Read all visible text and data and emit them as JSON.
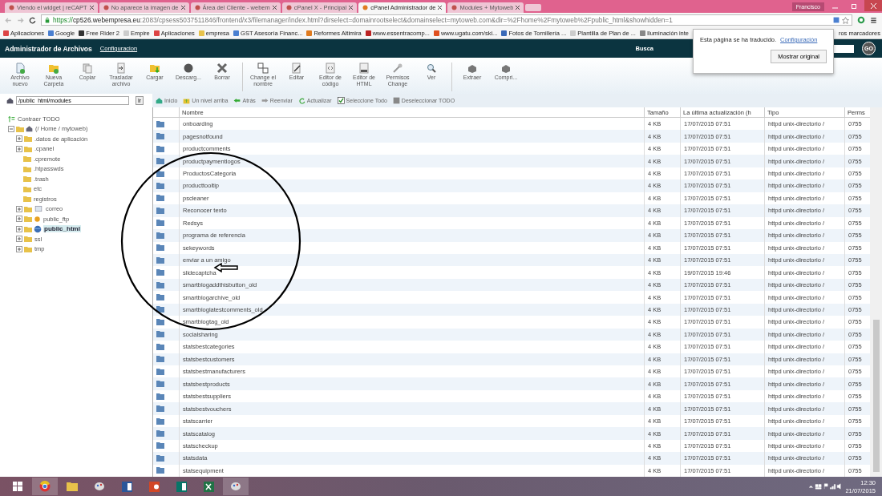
{
  "browser": {
    "tabs": [
      {
        "title": "Viendo el widget | reCAPT",
        "selected": false
      },
      {
        "title": "No aparece la imagen de",
        "selected": false
      },
      {
        "title": "Área del Cliente - webem",
        "selected": false
      },
      {
        "title": "cPanel X - Principal",
        "selected": false
      },
      {
        "title": "cPanel Administrador de",
        "selected": true
      },
      {
        "title": "Modules + Mytoweb",
        "selected": false
      }
    ],
    "profile": "Francisco",
    "url": {
      "scheme": "https://",
      "host": "cp526.webempresa.eu",
      "rest": ":2083/cpsess5037511846/frontend/x3/filemanager/index.html?dirselect=domainrootselect&domainselect=mytoweb.com&dir=%2Fhome%2Fmytoweb%2Fpublic_html&showhidden=1"
    },
    "bookmarks": [
      "Aplicaciones",
      "Google",
      "Free Rider 2",
      "Empire",
      "Aplicaciones",
      "empresa",
      "GST Asesoría Financ...",
      "Reformes Altimira",
      "www.essentracomp...",
      "www.ugatu.com/ski...",
      "Fotos de Tornillería ...",
      "Plantilla de Plan de ...",
      "Iluminación inte",
      "ros marcadores"
    ]
  },
  "translate_popup": {
    "message": "Esta página se ha traducido.",
    "link": "Configuración",
    "button": "Mostrar original"
  },
  "header": {
    "title": "Administrador de Archivos",
    "settings_link": "Configuracion",
    "search_label": "Busca",
    "go": "GO"
  },
  "toolbar": [
    [
      "Archivo nuevo",
      "Nueva Carpeta",
      "Copiar",
      "Trasladar archivo",
      "Cargar",
      "Descarg...",
      "Borrar"
    ],
    [
      "Change el nombre",
      "Editar",
      "Editor de código",
      "Editor de HTML",
      "Permisos Change",
      "Ver"
    ],
    [
      "Extraer",
      "Compri..."
    ]
  ],
  "path_bar": {
    "path": "/public_html/modules",
    "go": "Ir",
    "nav": [
      "Inicio",
      "Un nivel arriba",
      "Atrás",
      "Reenviar",
      "Actualizar",
      "Seleccione Todo",
      "Deseleccionar TODO"
    ]
  },
  "tree": {
    "collapse_all": "Contraer TODO",
    "root": {
      "label": "(/ Home / mytoweb)",
      "expanded": true,
      "children": [
        {
          "label": ".datos de aplicación",
          "kind": "folder",
          "expandable": true,
          "selected": false
        },
        {
          "label": ".cpanel",
          "kind": "folder",
          "expandable": true,
          "selected": false
        },
        {
          "label": ".cpremote",
          "kind": "folder",
          "expandable": false,
          "selected": false
        },
        {
          "label": ".htpasswds",
          "kind": "folder",
          "expandable": false,
          "selected": false
        },
        {
          "label": ".trash",
          "kind": "folder",
          "expandable": false,
          "selected": false
        },
        {
          "label": "etc",
          "kind": "folder",
          "expandable": false,
          "selected": false
        },
        {
          "label": "registros",
          "kind": "folder",
          "expandable": false,
          "selected": false
        },
        {
          "label": "correo",
          "kind": "mail",
          "expandable": true,
          "selected": false
        },
        {
          "label": "public_ftp",
          "kind": "ftp",
          "expandable": true,
          "selected": false
        },
        {
          "label": "public_html",
          "kind": "web",
          "expandable": true,
          "selected": true
        },
        {
          "label": "ssl",
          "kind": "folder",
          "expandable": true,
          "selected": false
        },
        {
          "label": "tmp",
          "kind": "folder",
          "expandable": true,
          "selected": false
        }
      ]
    }
  },
  "table": {
    "columns": [
      "Nombre",
      "Tamaño",
      "La última actualización (h",
      "Tipo",
      "Perms"
    ],
    "rows": [
      {
        "name": "onboarding",
        "size": "4 KB",
        "modified": "17/07/2015 07:51",
        "type": "httpd unix-directorio /",
        "perms": "0755"
      },
      {
        "name": "pagesnotfound",
        "size": "4 KB",
        "modified": "17/07/2015 07:51",
        "type": "httpd unix-directorio /",
        "perms": "0755"
      },
      {
        "name": "productcomments",
        "size": "4 KB",
        "modified": "17/07/2015 07:51",
        "type": "httpd unix-directorio /",
        "perms": "0755"
      },
      {
        "name": "productpaymentlogos",
        "size": "4 KB",
        "modified": "17/07/2015 07:51",
        "type": "httpd unix-directorio /",
        "perms": "0755"
      },
      {
        "name": "ProductosCategoria",
        "size": "4 KB",
        "modified": "17/07/2015 07:51",
        "type": "httpd unix-directorio /",
        "perms": "0755"
      },
      {
        "name": "producttooltip",
        "size": "4 KB",
        "modified": "17/07/2015 07:51",
        "type": "httpd unix-directorio /",
        "perms": "0755"
      },
      {
        "name": "pscleaner",
        "size": "4 KB",
        "modified": "17/07/2015 07:51",
        "type": "httpd unix-directorio /",
        "perms": "0755"
      },
      {
        "name": "Reconocer texto",
        "size": "4 KB",
        "modified": "17/07/2015 07:51",
        "type": "httpd unix-directorio /",
        "perms": "0755"
      },
      {
        "name": "Redsys",
        "size": "4 KB",
        "modified": "17/07/2015 07:51",
        "type": "httpd unix-directorio /",
        "perms": "0755"
      },
      {
        "name": "programa de referencia",
        "size": "4 KB",
        "modified": "17/07/2015 07:51",
        "type": "httpd unix-directorio /",
        "perms": "0755"
      },
      {
        "name": "sekeywords",
        "size": "4 KB",
        "modified": "17/07/2015 07:51",
        "type": "httpd unix-directorio /",
        "perms": "0755"
      },
      {
        "name": "enviar a un amigo",
        "size": "4 KB",
        "modified": "17/07/2015 07:51",
        "type": "httpd unix-directorio /",
        "perms": "0755"
      },
      {
        "name": "slidecaptcha",
        "size": "4 KB",
        "modified": "19/07/2015 19:46",
        "type": "httpd unix-directorio /",
        "perms": "0755"
      },
      {
        "name": "smartblogaddthisbutton_old",
        "size": "4 KB",
        "modified": "17/07/2015 07:51",
        "type": "httpd unix-directorio /",
        "perms": "0755"
      },
      {
        "name": "smartblogarchive_old",
        "size": "4 KB",
        "modified": "17/07/2015 07:51",
        "type": "httpd unix-directorio /",
        "perms": "0755"
      },
      {
        "name": "smartbloglatestcomments_old",
        "size": "4 KB",
        "modified": "17/07/2015 07:51",
        "type": "httpd unix-directorio /",
        "perms": "0755"
      },
      {
        "name": "smartblogtag_old",
        "size": "4 KB",
        "modified": "17/07/2015 07:51",
        "type": "httpd unix-directorio /",
        "perms": "0755"
      },
      {
        "name": "socialsharing",
        "size": "4 KB",
        "modified": "17/07/2015 07:51",
        "type": "httpd unix-directorio /",
        "perms": "0755"
      },
      {
        "name": "statsbestcategories",
        "size": "4 KB",
        "modified": "17/07/2015 07:51",
        "type": "httpd unix-directorio /",
        "perms": "0755"
      },
      {
        "name": "statsbestcustomers",
        "size": "4 KB",
        "modified": "17/07/2015 07:51",
        "type": "httpd unix-directorio /",
        "perms": "0755"
      },
      {
        "name": "statsbestmanufacturers",
        "size": "4 KB",
        "modified": "17/07/2015 07:51",
        "type": "httpd unix-directorio /",
        "perms": "0755"
      },
      {
        "name": "statsbestproducts",
        "size": "4 KB",
        "modified": "17/07/2015 07:51",
        "type": "httpd unix-directorio /",
        "perms": "0755"
      },
      {
        "name": "statsbestsuppliers",
        "size": "4 KB",
        "modified": "17/07/2015 07:51",
        "type": "httpd unix-directorio /",
        "perms": "0755"
      },
      {
        "name": "statsbestvouchers",
        "size": "4 KB",
        "modified": "17/07/2015 07:51",
        "type": "httpd unix-directorio /",
        "perms": "0755"
      },
      {
        "name": "statscarrier",
        "size": "4 KB",
        "modified": "17/07/2015 07:51",
        "type": "httpd unix-directorio /",
        "perms": "0755"
      },
      {
        "name": "statscatalog",
        "size": "4 KB",
        "modified": "17/07/2015 07:51",
        "type": "httpd unix-directorio /",
        "perms": "0755"
      },
      {
        "name": "statscheckup",
        "size": "4 KB",
        "modified": "17/07/2015 07:51",
        "type": "httpd unix-directorio /",
        "perms": "0755"
      },
      {
        "name": "statsdata",
        "size": "4 KB",
        "modified": "17/07/2015 07:51",
        "type": "httpd unix-directorio /",
        "perms": "0755"
      },
      {
        "name": "statsequipment",
        "size": "4 KB",
        "modified": "17/07/2015 07:51",
        "type": "httpd unix-directorio /",
        "perms": "0755"
      }
    ]
  },
  "taskbar": {
    "time": "12:30",
    "date": "21/07/2015"
  }
}
